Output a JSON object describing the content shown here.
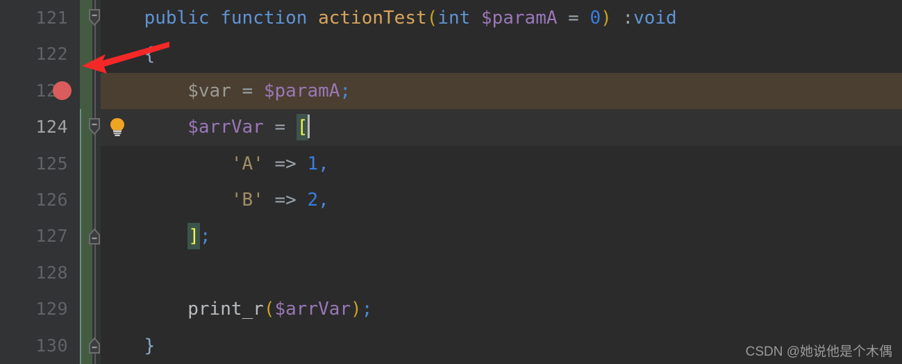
{
  "editor": {
    "theme": "darcula",
    "background": "#2b2b2b",
    "gutter_background": "#313335",
    "vcs_marker_color": "#445b42",
    "breakpoint_color": "#db5c5c",
    "breakpoint_line_background": "#4b3f31",
    "current_line_background": "#323232",
    "bracket_match_background": "#3d534c",
    "caret_color": "#bcbcbc"
  },
  "lines": [
    {
      "number": "121",
      "indent": "    ",
      "fold": "top",
      "tokens": [
        {
          "text": "public",
          "cls": "kw"
        },
        {
          "text": " ",
          "cls": "op"
        },
        {
          "text": "function",
          "cls": "kw"
        },
        {
          "text": " ",
          "cls": "op"
        },
        {
          "text": "actionTest",
          "cls": "fn"
        },
        {
          "text": "(",
          "cls": "paren"
        },
        {
          "text": "int",
          "cls": "type"
        },
        {
          "text": " ",
          "cls": "op"
        },
        {
          "text": "$paramA",
          "cls": "var"
        },
        {
          "text": " = ",
          "cls": "op"
        },
        {
          "text": "0",
          "cls": "num"
        },
        {
          "text": ")",
          "cls": "paren"
        },
        {
          "text": " ",
          "cls": "op"
        },
        {
          "text": ":",
          "cls": "op"
        },
        {
          "text": "void",
          "cls": "type"
        }
      ]
    },
    {
      "number": "122",
      "indent": "    ",
      "tokens": [
        {
          "text": "{",
          "cls": "brace-b"
        }
      ]
    },
    {
      "number": "123",
      "indent": "        ",
      "breakpoint": true,
      "highlight": "breakpoint",
      "tokens": [
        {
          "text": "$var",
          "cls": "plainvar"
        },
        {
          "text": " = ",
          "cls": "op"
        },
        {
          "text": "$paramA",
          "cls": "var"
        },
        {
          "text": ";",
          "cls": "semi"
        }
      ]
    },
    {
      "number": "124",
      "indent": "        ",
      "fold": "top",
      "bulb": true,
      "current": true,
      "highlight": "current",
      "tokens": [
        {
          "text": "$arrVar",
          "cls": "var"
        },
        {
          "text": " = ",
          "cls": "op"
        },
        {
          "text": "[",
          "cls": "bracket-hl"
        },
        {
          "text": "",
          "cls": "caret"
        }
      ]
    },
    {
      "number": "125",
      "indent": "            ",
      "tokens": [
        {
          "text": "'A'",
          "cls": "str"
        },
        {
          "text": " => ",
          "cls": "op"
        },
        {
          "text": "1",
          "cls": "num"
        },
        {
          "text": ",",
          "cls": "semi"
        }
      ]
    },
    {
      "number": "126",
      "indent": "            ",
      "tokens": [
        {
          "text": "'B'",
          "cls": "str"
        },
        {
          "text": " => ",
          "cls": "op"
        },
        {
          "text": "2",
          "cls": "num"
        },
        {
          "text": ",",
          "cls": "semi"
        }
      ]
    },
    {
      "number": "127",
      "indent": "        ",
      "fold": "bottom",
      "tokens": [
        {
          "text": "]",
          "cls": "bracket-hl"
        },
        {
          "text": ";",
          "cls": "semi"
        }
      ]
    },
    {
      "number": "128",
      "indent": "",
      "tokens": []
    },
    {
      "number": "129",
      "indent": "        ",
      "tokens": [
        {
          "text": "print_r",
          "cls": "ident"
        },
        {
          "text": "(",
          "cls": "paren"
        },
        {
          "text": "$arrVar",
          "cls": "var"
        },
        {
          "text": ")",
          "cls": "paren"
        },
        {
          "text": ";",
          "cls": "semi"
        }
      ]
    },
    {
      "number": "130",
      "indent": "    ",
      "fold": "bottom",
      "tokens": [
        {
          "text": "}",
          "cls": "brace-b"
        }
      ]
    }
  ],
  "annotation": {
    "type": "arrow",
    "color": "#f52828",
    "points_to": "vcs-change-marker",
    "origin": "opening-brace-line-122"
  },
  "watermark": {
    "text": "CSDN @她说他是个木偶"
  }
}
